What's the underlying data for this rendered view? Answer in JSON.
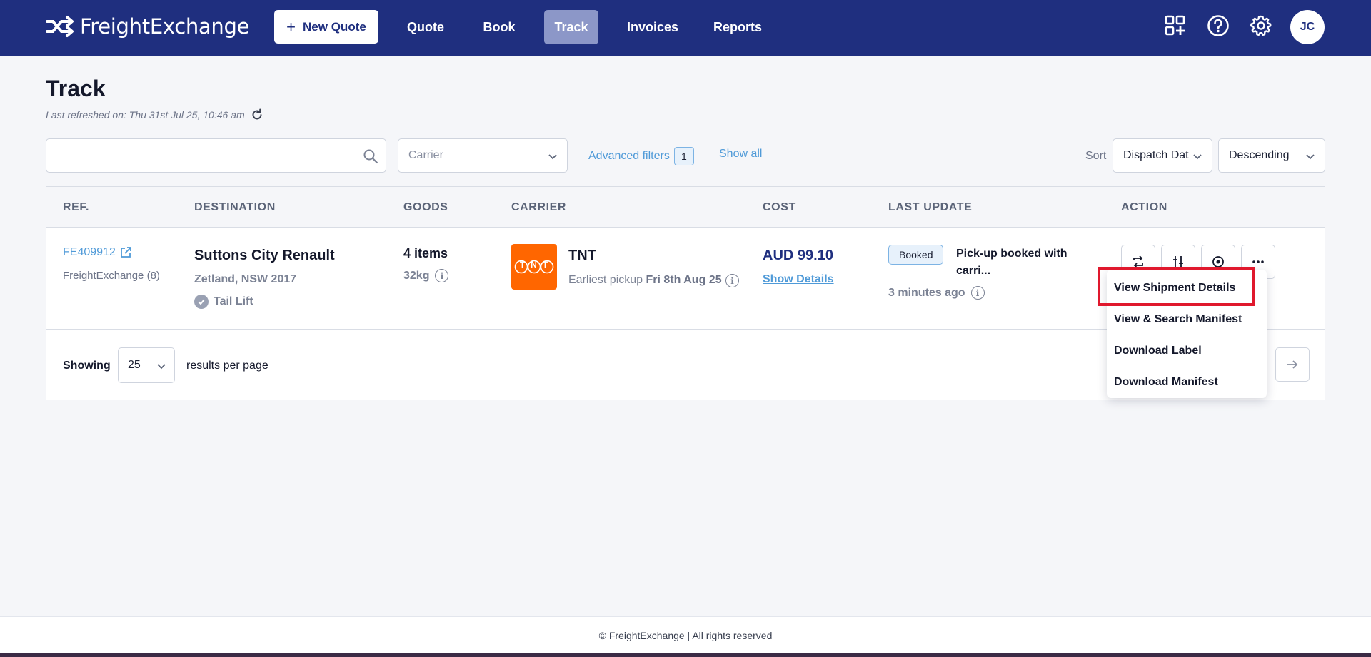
{
  "header": {
    "logo_text": "FreightExchange",
    "new_quote_label": "New Quote",
    "nav": [
      {
        "label": "Quote"
      },
      {
        "label": "Book"
      },
      {
        "label": "Track"
      },
      {
        "label": "Invoices"
      },
      {
        "label": "Reports"
      }
    ],
    "active_nav": "Track",
    "avatar_initials": "JC",
    "icons": [
      "apps-add-icon",
      "help-icon",
      "settings-gear-icon"
    ],
    "colors": {
      "bar": "#1f2f7f",
      "active_tab": "#8c97c8"
    }
  },
  "page": {
    "title": "Track",
    "last_refreshed": "Last refreshed on: Thu 31st Jul 25, 10:46 am"
  },
  "filters": {
    "search_value": "",
    "carrier_placeholder": "Carrier",
    "advanced_label": "Advanced filters",
    "advanced_count": "1",
    "show_all_label": "Show all",
    "sort_label": "Sort",
    "sort_field": "Dispatch Dat",
    "sort_order": "Descending"
  },
  "table": {
    "columns": [
      "REF.",
      "DESTINATION",
      "GOODS",
      "CARRIER",
      "COST",
      "LAST UPDATE",
      "ACTION"
    ],
    "rows": [
      {
        "ref": "FE409912",
        "ref_sub": "FreightExchange (8)",
        "destination": "Suttons City Renault",
        "address": "Zetland, NSW 2017",
        "tail_lift": "Tail Lift",
        "items": "4 items",
        "weight": "32kg",
        "carrier_logo_text": "TNT",
        "carrier": "TNT",
        "pickup_prefix": "Earliest pickup",
        "pickup_date": "Fri 8th Aug 25",
        "cost": "AUD 99.10",
        "cost_link": "Show Details",
        "status": "Booked",
        "status_text": "Pick-up booked with carri...",
        "updated": "3 minutes ago"
      }
    ]
  },
  "pagination": {
    "showing_label": "Showing",
    "per_page": "25",
    "results_label": "results per page"
  },
  "action_menu": {
    "items": [
      "View Shipment Details",
      "View & Search Manifest",
      "Download Label",
      "Download Manifest"
    ],
    "highlighted": "View Shipment Details"
  },
  "footer": {
    "text": "© FreightExchange | All rights reserved"
  }
}
